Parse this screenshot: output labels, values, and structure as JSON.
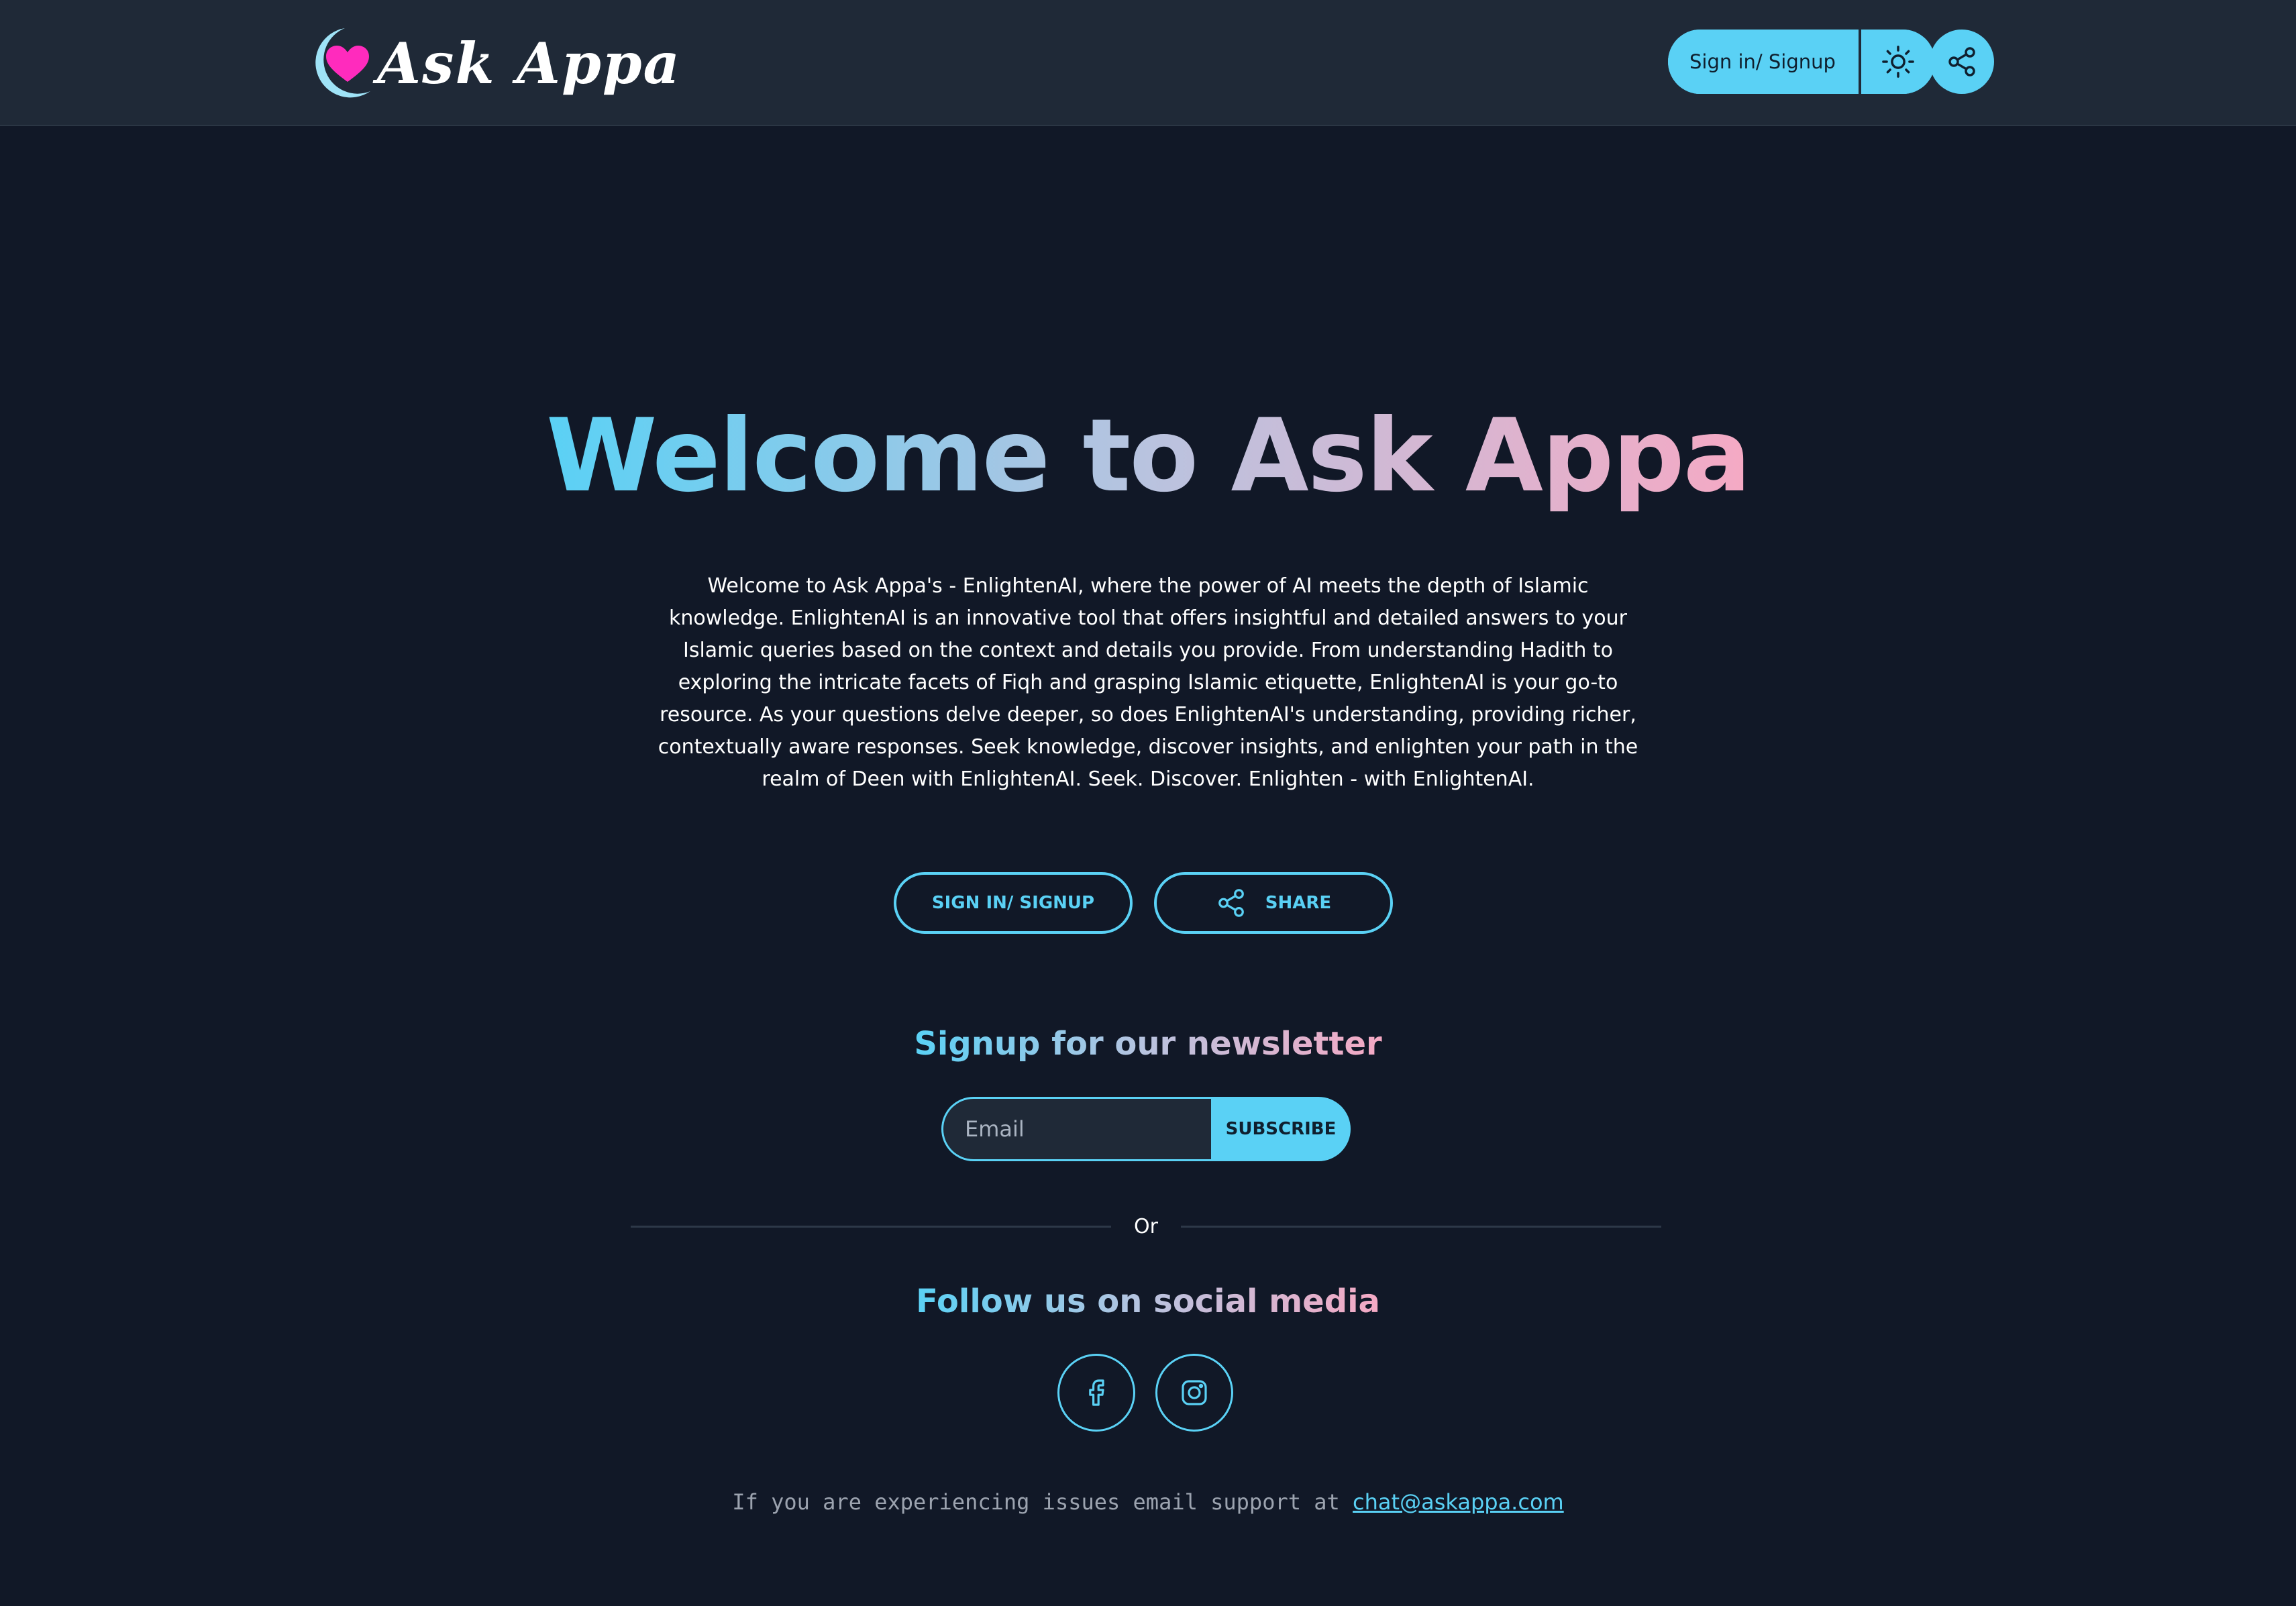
{
  "header": {
    "logo_text": "Ask Appa",
    "signin_label": "Sign in/ Signup",
    "theme_icon": "sun-icon",
    "share_icon": "share-icon"
  },
  "hero": {
    "title_part1": "Welcome to",
    "title_part2": "Ask Appa",
    "description": "Welcome to Ask Appa's - EnlightenAI, where the power of AI meets the depth of Islamic knowledge. EnlightenAI is an innovative tool that offers insightful and detailed answers to your Islamic queries based on the context and details you provide. From understanding Hadith to exploring the intricate facets of Fiqh and grasping Islamic etiquette, EnlightenAI is your go-to resource. As your questions delve deeper, so does EnlightenAI's understanding, providing richer, contextually aware responses. Seek knowledge, discover insights, and enlighten your path in the realm of Deen with EnlightenAI. Seek. Discover. Enlighten - with EnlightenAI.",
    "signin_button": "Sign in/ Signup",
    "share_button": "Share"
  },
  "newsletter": {
    "title": "Signup for our newsletter",
    "email_placeholder": "Email",
    "subscribe_label": "Subscribe"
  },
  "divider_text": "Or",
  "social": {
    "title": "Follow us on social media",
    "icons": [
      "facebook-icon",
      "instagram-icon"
    ]
  },
  "footer": {
    "text": "If you are experiencing issues email support at",
    "email": "chat@askappa.com"
  },
  "colors": {
    "background": "#111827",
    "header": "#1f2937",
    "accent": "#5ad1f5",
    "pink": "#f5a9c4",
    "heart": "#ff2bbd"
  }
}
